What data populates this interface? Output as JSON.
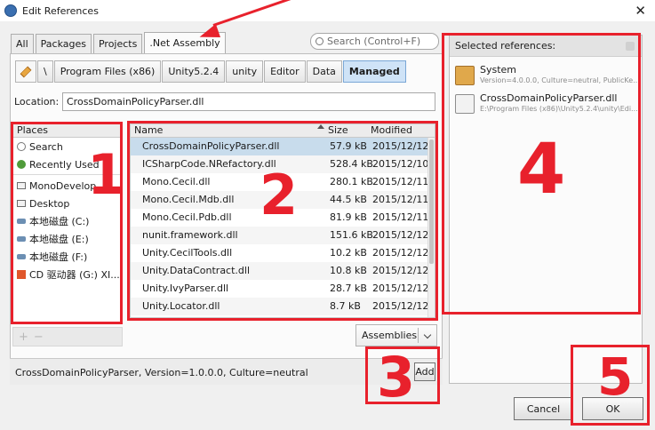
{
  "window": {
    "title": "Edit References",
    "close_glyph": "✕"
  },
  "tabs": [
    {
      "label": "All",
      "active": false
    },
    {
      "label": "Packages",
      "active": false
    },
    {
      "label": "Projects",
      "active": false
    },
    {
      "label": ".Net Assembly",
      "active": true
    }
  ],
  "search": {
    "placeholder": "Search (Control+F)"
  },
  "path_buttons": [
    {
      "label": "\\"
    },
    {
      "label": "Program Files (x86)"
    },
    {
      "label": "Unity5.2.4"
    },
    {
      "label": "unity"
    },
    {
      "label": "Editor"
    },
    {
      "label": "Data"
    },
    {
      "label": "Managed",
      "selected": true
    }
  ],
  "location": {
    "label": "Location:",
    "value": "CrossDomainPolicyParser.dll"
  },
  "places": {
    "header": "Places",
    "items": [
      {
        "label": "Search",
        "icon": "search-icon"
      },
      {
        "label": "Recently Used",
        "icon": "recent-icon"
      },
      {
        "label": "MonoDevelop",
        "icon": "folder-icon"
      },
      {
        "label": "Desktop",
        "icon": "folder-icon"
      },
      {
        "label": "本地磁盘 (C:)",
        "icon": "disk-icon"
      },
      {
        "label": "本地磁盘 (E:)",
        "icon": "disk-icon"
      },
      {
        "label": "本地磁盘 (F:)",
        "icon": "disk-icon"
      },
      {
        "label": "CD 驱动器 (G:) XI...",
        "icon": "cd-icon"
      }
    ],
    "add_glyph": "+",
    "remove_glyph": "−"
  },
  "files": {
    "headers": {
      "name": "Name",
      "size": "Size",
      "modified": "Modified"
    },
    "rows": [
      {
        "name": "CrossDomainPolicyParser.dll",
        "size": "57.9 kB",
        "modified": "2015/12/12"
      },
      {
        "name": "ICSharpCode.NRefactory.dll",
        "size": "528.4 kB",
        "modified": "2015/12/10"
      },
      {
        "name": "Mono.Cecil.dll",
        "size": "280.1 kB",
        "modified": "2015/12/11"
      },
      {
        "name": "Mono.Cecil.Mdb.dll",
        "size": "44.5 kB",
        "modified": "2015/12/11"
      },
      {
        "name": "Mono.Cecil.Pdb.dll",
        "size": "81.9 kB",
        "modified": "2015/12/11"
      },
      {
        "name": "nunit.framework.dll",
        "size": "151.6 kB",
        "modified": "2015/12/12"
      },
      {
        "name": "Unity.CecilTools.dll",
        "size": "10.2 kB",
        "modified": "2015/12/12"
      },
      {
        "name": "Unity.DataContract.dll",
        "size": "10.8 kB",
        "modified": "2015/12/12"
      },
      {
        "name": "Unity.IvyParser.dll",
        "size": "28.7 kB",
        "modified": "2015/12/12"
      },
      {
        "name": "Unity.Locator.dll",
        "size": "8.7 kB",
        "modified": "2015/12/12"
      }
    ]
  },
  "filter_combo": {
    "value": "Assemblies"
  },
  "status": {
    "text": "CrossDomainPolicyParser, Version=1.0.0.0, Culture=neutral",
    "add_label": "Add"
  },
  "selected_refs": {
    "header": "Selected references:",
    "items": [
      {
        "name": "System",
        "detail": "Version=4.0.0.0, Culture=neutral, PublicKe...",
        "icon": "package-icon"
      },
      {
        "name": "CrossDomainPolicyParser.dll",
        "detail": "E:\\Program Files (x86)\\Unity5.2.4\\unity\\Edi...",
        "icon": "dll-icon"
      }
    ]
  },
  "buttons": {
    "cancel": "Cancel",
    "ok": "OK"
  },
  "annotations": {
    "n1": "1",
    "n2": "2",
    "n3": "3",
    "n4": "4",
    "n5": "5",
    "color": "#e8212c"
  }
}
